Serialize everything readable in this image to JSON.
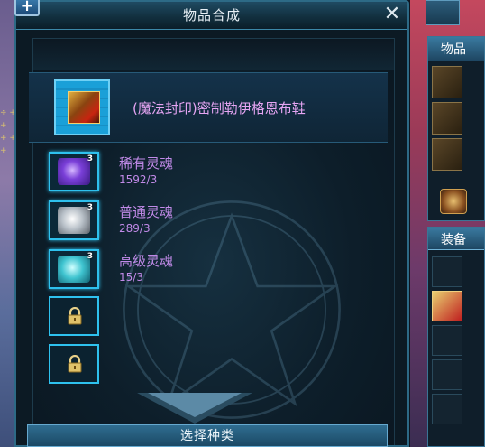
{
  "window": {
    "title": "物品合成",
    "add_label": "+",
    "close_label": "✕"
  },
  "product": {
    "name": "(魔法封印)密制勒伊格恩布鞋"
  },
  "materials": [
    {
      "name": "稀有灵魂",
      "qty": "1592/3",
      "count": "3",
      "icon": "purple-soul-icon"
    },
    {
      "name": "普通灵魂",
      "qty": "289/3",
      "count": "3",
      "icon": "white-soul-icon"
    },
    {
      "name": "高级灵魂",
      "qty": "15/3",
      "count": "3",
      "icon": "teal-soul-icon"
    }
  ],
  "locked_slot_count": 2,
  "buttons": {
    "select_type": "选择种类"
  },
  "side": {
    "panel1_title": "物品",
    "panel2_title": "装备"
  },
  "colors": {
    "item_name": "#e6a5f3",
    "material_text": "#c18ae8",
    "slot_border": "#2ec1ee"
  }
}
